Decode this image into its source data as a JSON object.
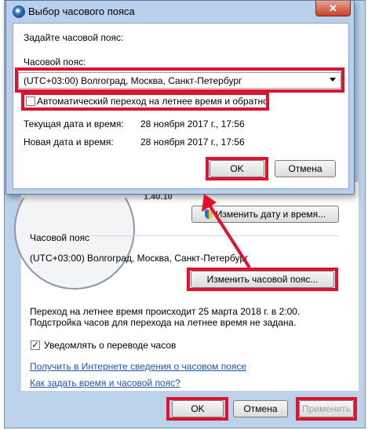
{
  "modal": {
    "title": "Выбор часового пояса",
    "close_label": "✕",
    "prompt": "Задайте часовой пояс:",
    "timezone_label": "Часовой пояс:",
    "timezone_value": "(UTC+03:00) Волгоград, Москва, Санкт-Петербург",
    "dst_label": "Автоматический переход на летнее время и обратно",
    "current_label": "Текущая дата и время:",
    "current_value": "28 ноября 2017 г., 17:56",
    "new_label": "Новая дата и время:",
    "new_value": "28 ноября 2017 г., 17:56",
    "ok_label": "OK",
    "cancel_label": "Отмена"
  },
  "parent": {
    "date_peek": "1.40.10",
    "change_datetime_label": "Изменить дату и время...",
    "timezone_heading": "Часовой пояс",
    "timezone_value": "(UTC+03:00) Волгоград, Москва, Санкт-Петербург",
    "change_timezone_label": "Изменить часовой пояс...",
    "dst_info_line1": "Переход на летнее время происходит 25 марта 2018 г. в 2:00.",
    "dst_info_line2": "Подстройка часов для перехода на летнее время не задана.",
    "notify_label": "Уведомлять о переводе часов",
    "link_online": "Получить в Интернете сведения о часовом поясе",
    "link_howto": "Как задать время и часовой пояс?",
    "ok_label": "OK",
    "cancel_label": "Отмена",
    "apply_label": "Применить"
  },
  "colors": {
    "highlight": "#e0132f",
    "link": "#1a55c0",
    "frame": "#b8d0ec"
  }
}
